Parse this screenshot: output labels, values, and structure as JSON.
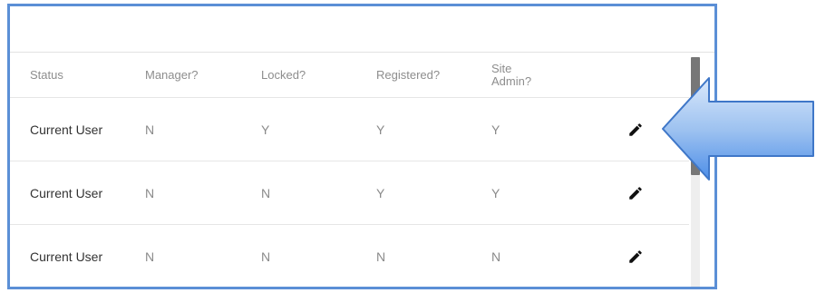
{
  "table": {
    "headers": {
      "status": "Status",
      "manager": "Manager?",
      "locked": "Locked?",
      "registered": "Registered?",
      "site_admin": "Site\nAdmin?"
    },
    "rows": [
      {
        "status": "Current User",
        "manager": "N",
        "locked": "Y",
        "registered": "Y",
        "site_admin": "Y"
      },
      {
        "status": "Current User",
        "manager": "N",
        "locked": "N",
        "registered": "Y",
        "site_admin": "Y"
      },
      {
        "status": "Current User",
        "manager": "N",
        "locked": "N",
        "registered": "N",
        "site_admin": "N"
      }
    ]
  },
  "icons": {
    "edit": "pencil-icon",
    "pointer": "arrow-left-icon"
  },
  "colors": {
    "frame_border": "#5b8fd6",
    "arrow_fill_light": "#dbe9fb",
    "arrow_fill_dark": "#4d8ee8",
    "arrow_stroke": "#3f77c8"
  }
}
